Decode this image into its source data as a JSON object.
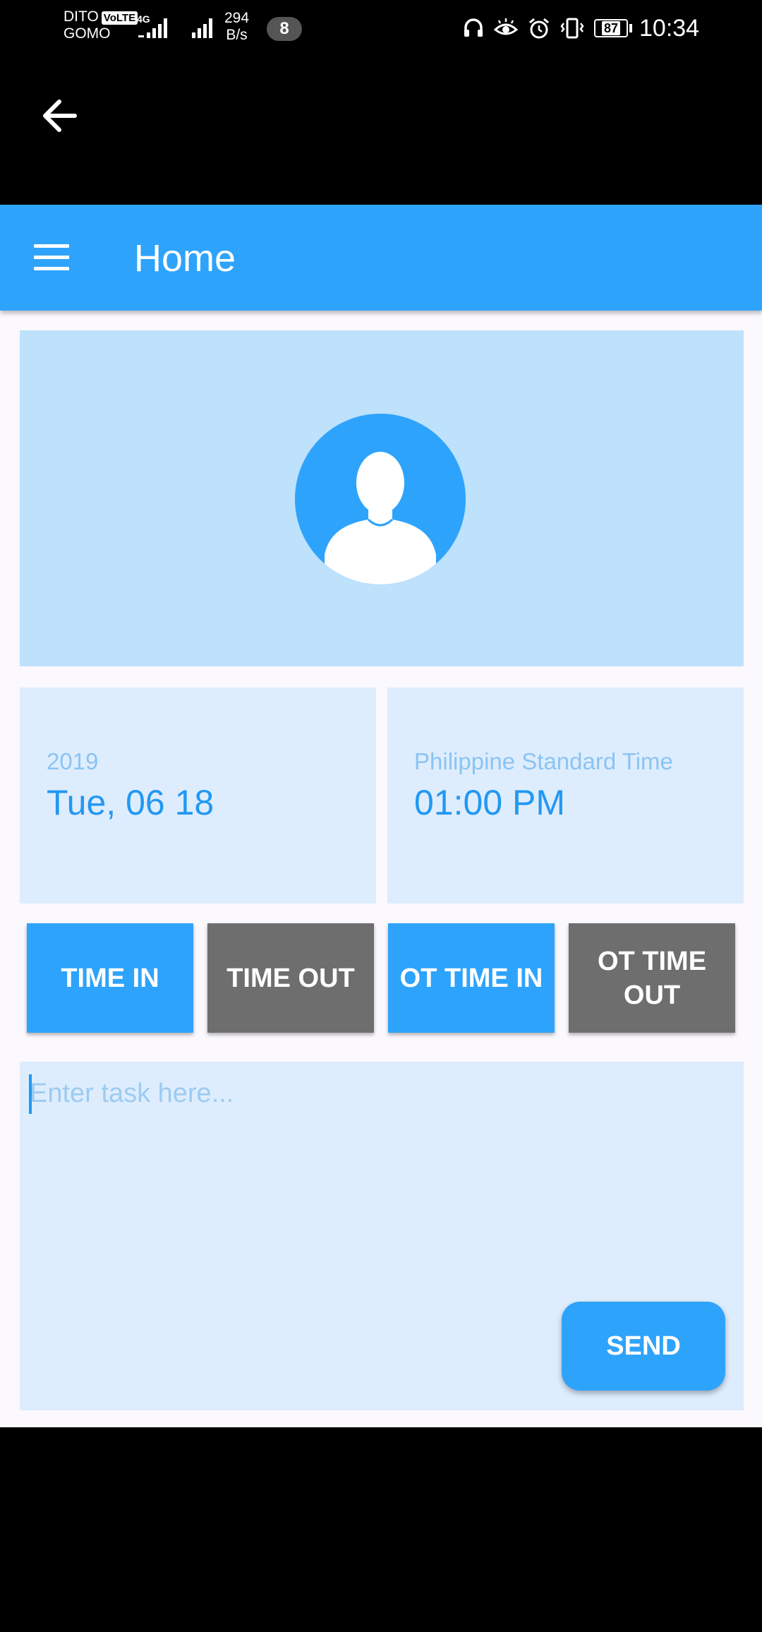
{
  "status_bar": {
    "carrier_top": "DITO",
    "volte": "VoLTE",
    "carrier_bottom": "GOMO",
    "network": "4G",
    "speed_value": "294",
    "speed_unit": "B/s",
    "notification_count": "8",
    "battery": "87",
    "time": "10:34"
  },
  "app_bar": {
    "title": "Home"
  },
  "date_card": {
    "year": "2019",
    "date": "Tue, 06 18"
  },
  "time_card": {
    "timezone": "Philippine Standard Time",
    "time": "01:00 PM"
  },
  "buttons": {
    "time_in": "TIME IN",
    "time_out": "TIME OUT",
    "ot_time_in": "OT TIME IN",
    "ot_time_out": "OT TIME OUT"
  },
  "task": {
    "placeholder": "Enter task here...",
    "value": ""
  },
  "send_label": "SEND",
  "colors": {
    "primary": "#2ea3fb",
    "inactive_button": "#6e6e6e",
    "panel_light": "#deedfd",
    "profile_panel": "#bee1fc"
  }
}
